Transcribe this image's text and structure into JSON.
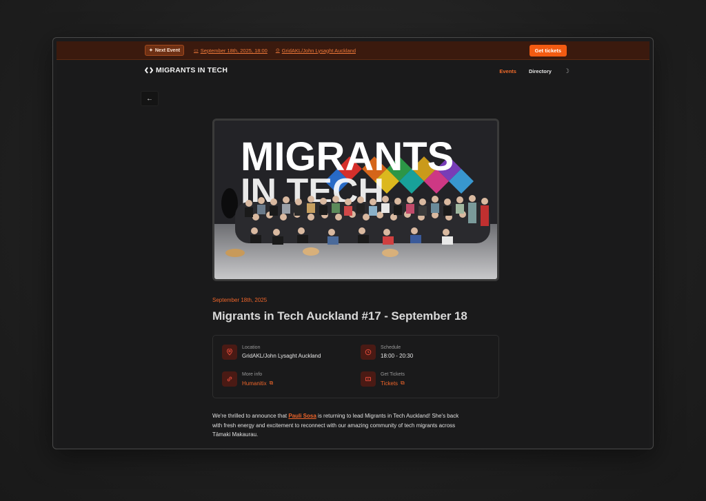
{
  "banner": {
    "badge_icon": "sparkle-icon",
    "badge_label": "Next Event",
    "date_icon": "calendar-icon",
    "date_text": "September 18th, 2025, 18:00",
    "location_icon": "map-pin-icon",
    "location_text": "GridAKL/John Lysaght Auckland",
    "cta_label": "Get tickets"
  },
  "nav": {
    "logo_text": "MIGRANTS IN TECH",
    "links": [
      {
        "label": "Events",
        "active": true
      },
      {
        "label": "Directory",
        "active": false
      }
    ],
    "theme_icon": "moon-icon"
  },
  "back_icon": "arrow-left-icon",
  "hero": {
    "image_text_line1": "MIGRANTS",
    "image_text_line2": "IN TECH",
    "alt": "Group photo of Migrants in Tech community"
  },
  "event": {
    "date": "September 18th, 2025",
    "title": "Migrants in Tech Auckland #17 - September 18"
  },
  "details": {
    "location": {
      "label": "Location",
      "value": "GridAKL/John Lysaght Auckland",
      "icon": "map-pin-icon"
    },
    "schedule": {
      "label": "Schedule",
      "value": "18:00 - 20:30",
      "icon": "clock-icon"
    },
    "more_info": {
      "label": "More info",
      "value": "Humanitix",
      "icon": "link-icon"
    },
    "tickets": {
      "label": "Get Tickets",
      "value": "Tickets",
      "icon": "ticket-icon"
    }
  },
  "description": {
    "before": "We're thrilled to announce that ",
    "person": "Pauli Sosa",
    "after": " is returning to lead Migrants in Tech Auckland! She's back with fresh energy and excitement to reconnect with our amazing community of tech migrants across Tāmaki Makaurau."
  },
  "colors": {
    "accent": "#f35b12",
    "accent_text": "#f0652a",
    "banner_bg": "#3b1a0e",
    "page_bg": "#1a1a1b"
  }
}
